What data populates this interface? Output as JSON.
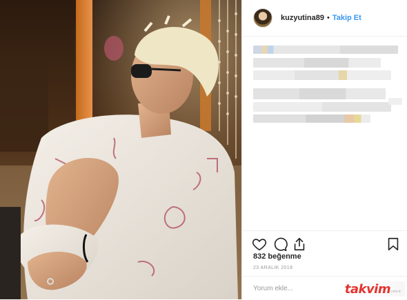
{
  "post": {
    "username": "kuzyutina89",
    "separator": "•",
    "follow_label": "Takip Et",
    "likes_text": "832 beğenme",
    "date_text": "23 ARALIK 2018",
    "comment_placeholder": "Yorum ekle...",
    "watermark_text": "takvim",
    "watermark_sub": "com.tr"
  },
  "icons": {
    "like": "heart-icon",
    "comment": "comment-icon",
    "share": "share-icon",
    "save": "bookmark-icon"
  },
  "colors": {
    "accent": "#3897f0",
    "watermark": "#e3342f",
    "border": "#efefef",
    "muted": "#999999"
  }
}
